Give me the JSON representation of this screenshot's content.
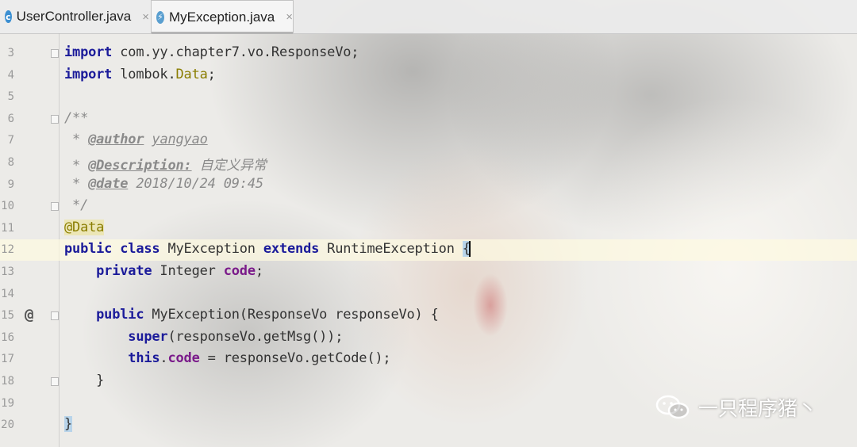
{
  "tabs": [
    {
      "label": "UserController.java",
      "icon": "java-class-icon",
      "icon_glyph": "c",
      "active": false
    },
    {
      "label": "MyException.java",
      "icon": "java-exception-icon",
      "icon_glyph": "⚡",
      "active": true
    }
  ],
  "tab_close_glyph": "×",
  "top_line_number": "",
  "lines": [
    {
      "n": "3",
      "segments": [
        {
          "t": "import",
          "c": "kw"
        },
        {
          "t": " com.yy.chapter7.vo.ResponseVo;",
          "c": ""
        }
      ]
    },
    {
      "n": "4",
      "segments": [
        {
          "t": "import",
          "c": "kw"
        },
        {
          "t": " lombok.",
          "c": ""
        },
        {
          "t": "Data",
          "c": "ann"
        },
        {
          "t": ";",
          "c": ""
        }
      ]
    },
    {
      "n": "5",
      "segments": []
    },
    {
      "n": "6",
      "segments": [
        {
          "t": "/**",
          "c": "doc"
        }
      ]
    },
    {
      "n": "7",
      "segments": [
        {
          "t": " * ",
          "c": "doc"
        },
        {
          "t": "@author",
          "c": "tag"
        },
        {
          "t": " ",
          "c": "doc"
        },
        {
          "t": "yangyao",
          "c": "tagref"
        }
      ]
    },
    {
      "n": "8",
      "segments": [
        {
          "t": " * ",
          "c": "doc"
        },
        {
          "t": "@Description:",
          "c": "tag"
        },
        {
          "t": " 自定义异常",
          "c": "doc"
        }
      ]
    },
    {
      "n": "9",
      "segments": [
        {
          "t": " * ",
          "c": "doc"
        },
        {
          "t": "@date",
          "c": "tag"
        },
        {
          "t": " 2018/10/24 09:45",
          "c": "doc"
        }
      ]
    },
    {
      "n": "10",
      "segments": [
        {
          "t": " */",
          "c": "doc"
        }
      ]
    },
    {
      "n": "11",
      "segments": [
        {
          "t": "@Data",
          "c": "ann annbox"
        }
      ]
    },
    {
      "n": "12",
      "segments": [
        {
          "t": "public class",
          "c": "kw"
        },
        {
          "t": " MyException ",
          "c": ""
        },
        {
          "t": "extends",
          "c": "kw"
        },
        {
          "t": " RuntimeException ",
          "c": ""
        },
        {
          "t": "{",
          "c": "brace-hl"
        }
      ],
      "current": true
    },
    {
      "n": "13",
      "segments": [
        {
          "t": "    ",
          "c": ""
        },
        {
          "t": "private",
          "c": "kw"
        },
        {
          "t": " Integer ",
          "c": ""
        },
        {
          "t": "code",
          "c": "fld"
        },
        {
          "t": ";",
          "c": ""
        }
      ]
    },
    {
      "n": "14",
      "segments": []
    },
    {
      "n": "15",
      "segments": [
        {
          "t": "    ",
          "c": ""
        },
        {
          "t": "public",
          "c": "kw"
        },
        {
          "t": " MyException(ResponseVo responseVo) {",
          "c": ""
        }
      ]
    },
    {
      "n": "16",
      "segments": [
        {
          "t": "        ",
          "c": ""
        },
        {
          "t": "super",
          "c": "kw"
        },
        {
          "t": "(responseVo.getMsg());",
          "c": ""
        }
      ]
    },
    {
      "n": "17",
      "segments": [
        {
          "t": "        ",
          "c": ""
        },
        {
          "t": "this",
          "c": "kw"
        },
        {
          "t": ".",
          "c": ""
        },
        {
          "t": "code",
          "c": "fld"
        },
        {
          "t": " = responseVo.getCode();",
          "c": ""
        }
      ]
    },
    {
      "n": "18",
      "segments": [
        {
          "t": "    }",
          "c": ""
        }
      ]
    },
    {
      "n": "19",
      "segments": []
    },
    {
      "n": "20",
      "segments": [
        {
          "t": "}",
          "c": "brace-hl"
        }
      ]
    }
  ],
  "override_marker": "@",
  "watermark": {
    "text": "一只程序猪丶",
    "icon": "wechat-icon"
  }
}
